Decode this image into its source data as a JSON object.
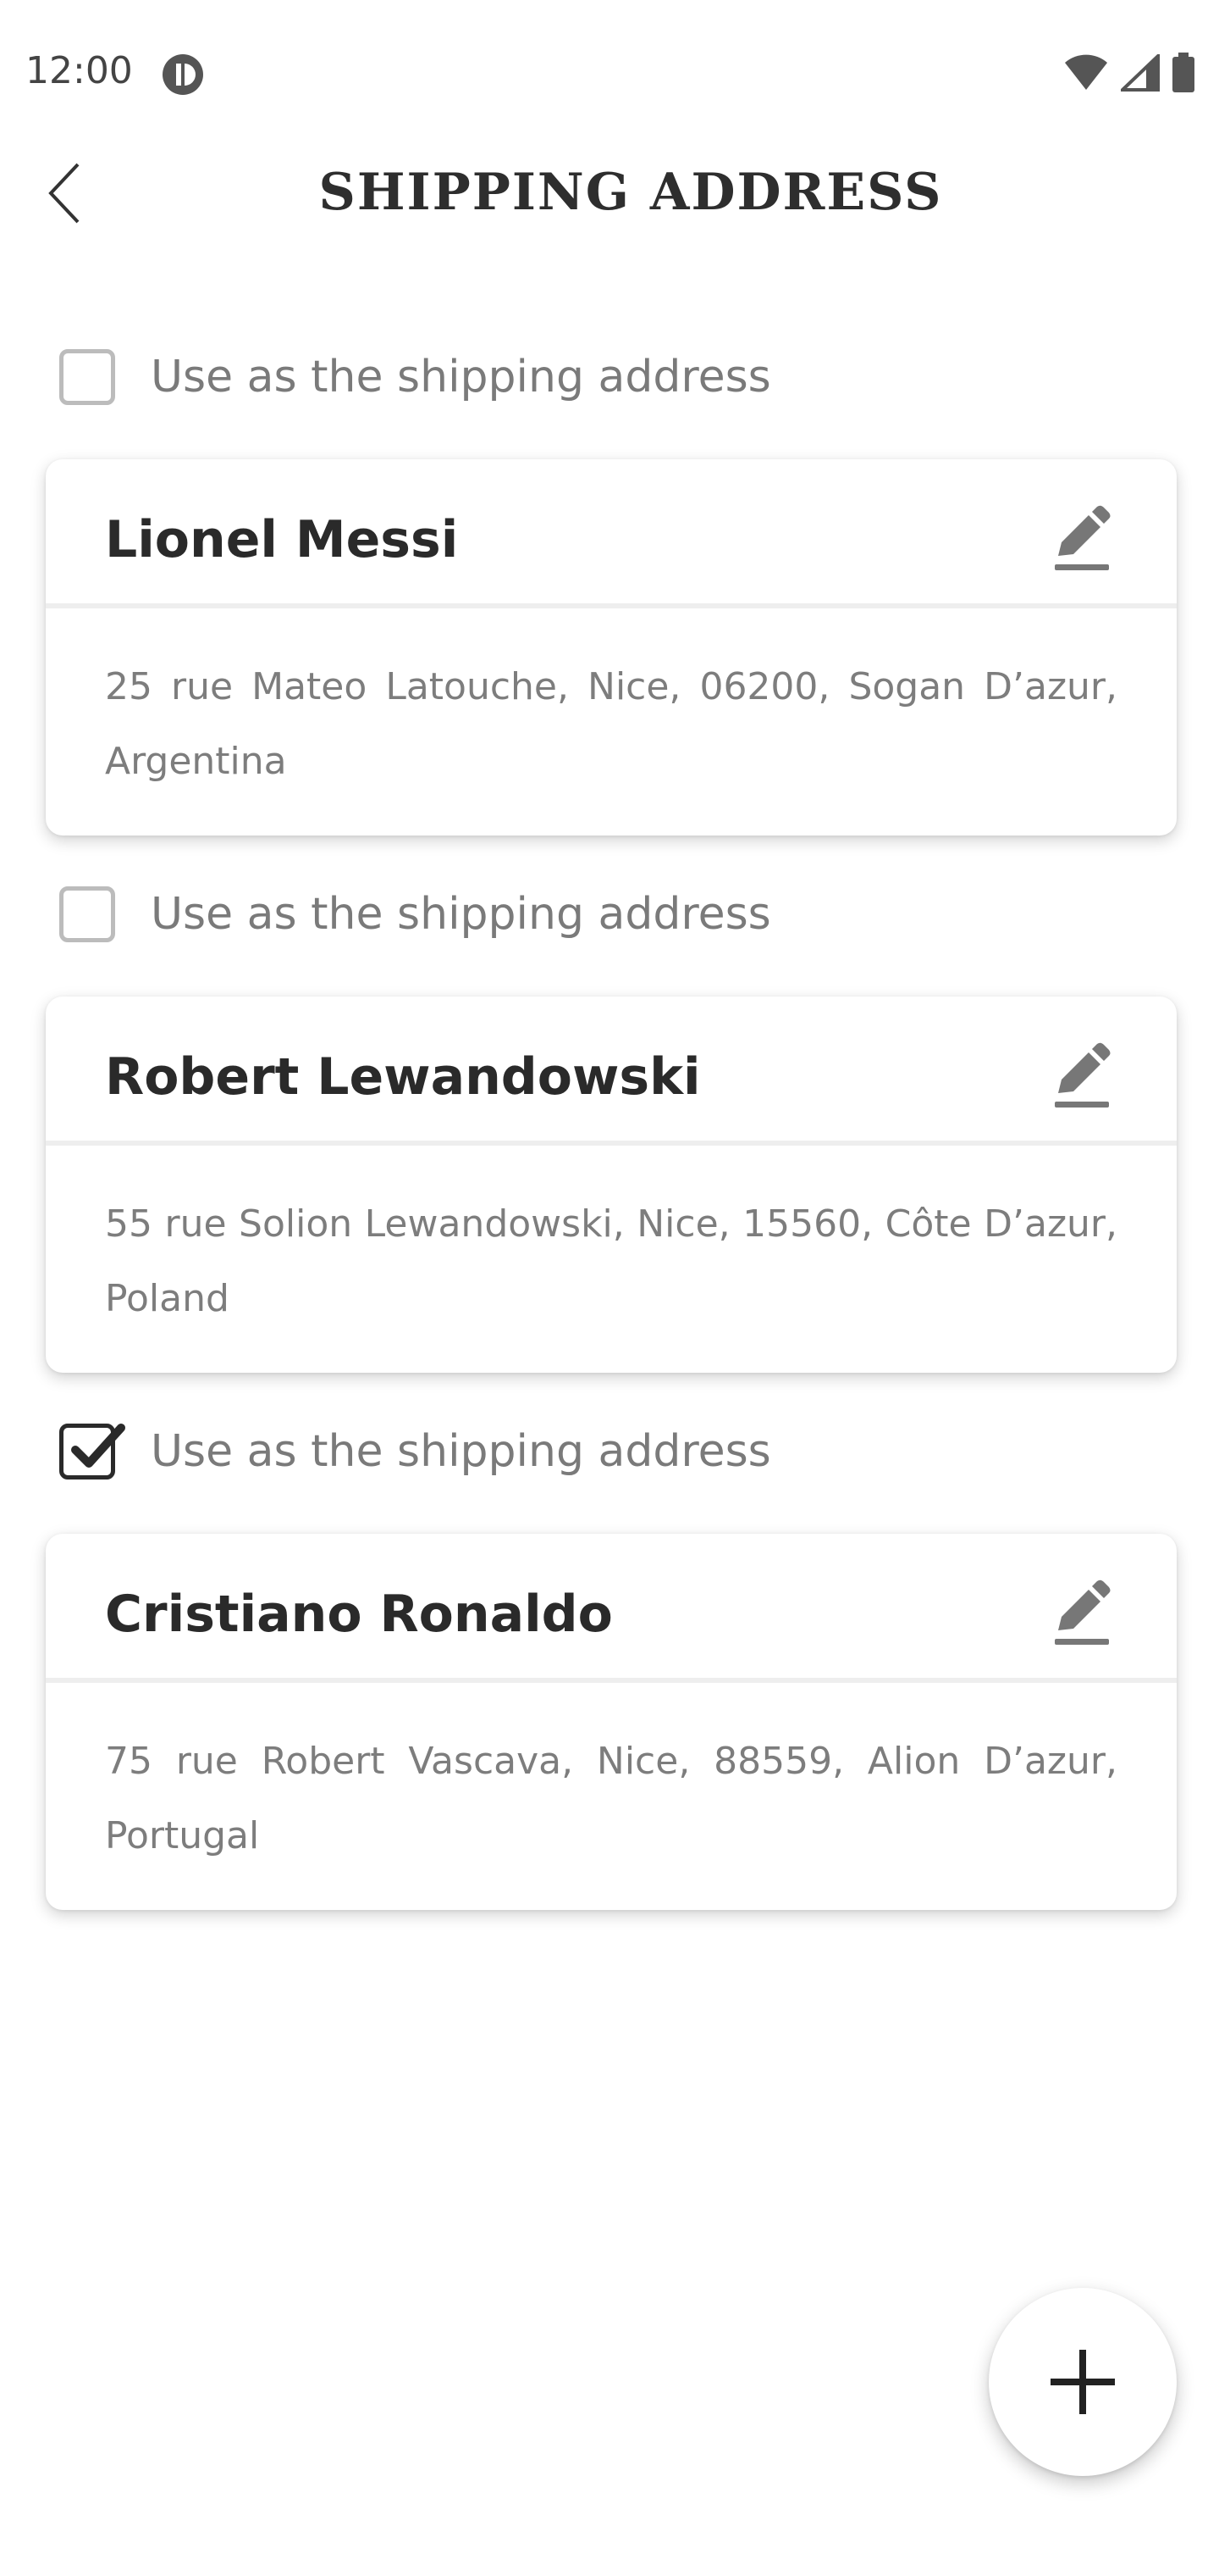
{
  "status_bar": {
    "time": "12:00",
    "icons": [
      "app-notification-icon",
      "wifi-icon",
      "signal-icon",
      "battery-icon"
    ]
  },
  "header": {
    "title": "SHIPPING ADDRESS",
    "back_icon": "chevron-left-icon"
  },
  "addresses": [
    {
      "shipping_label": "Use as the shipping address",
      "checked": false,
      "name": "Lionel Messi",
      "address": "25 rue Mateo Latouche, Nice, 06200, Sogan D’azur, Argentina",
      "edit_icon": "pencil-icon"
    },
    {
      "shipping_label": "Use as the shipping address",
      "checked": false,
      "name": "Robert Lewandowski",
      "address": "55 rue Solion Lewandowski, Nice, 15560, Côte D’azur, Poland",
      "edit_icon": "pencil-icon"
    },
    {
      "shipping_label": "Use as the shipping address",
      "checked": true,
      "name": "Cristiano Ronaldo",
      "address": "75 rue Robert Vascava, Nice, 88559, Alion D’azur, Portugal",
      "edit_icon": "pencil-icon"
    }
  ],
  "fab": {
    "icon": "plus-icon"
  },
  "colors": {
    "text_primary": "#2a2a2a",
    "text_secondary": "#7d7d7d",
    "checkbox_unchecked": "#bcbcbc",
    "checkbox_checked": "#2a2a2a",
    "divider": "#eeeeee"
  }
}
